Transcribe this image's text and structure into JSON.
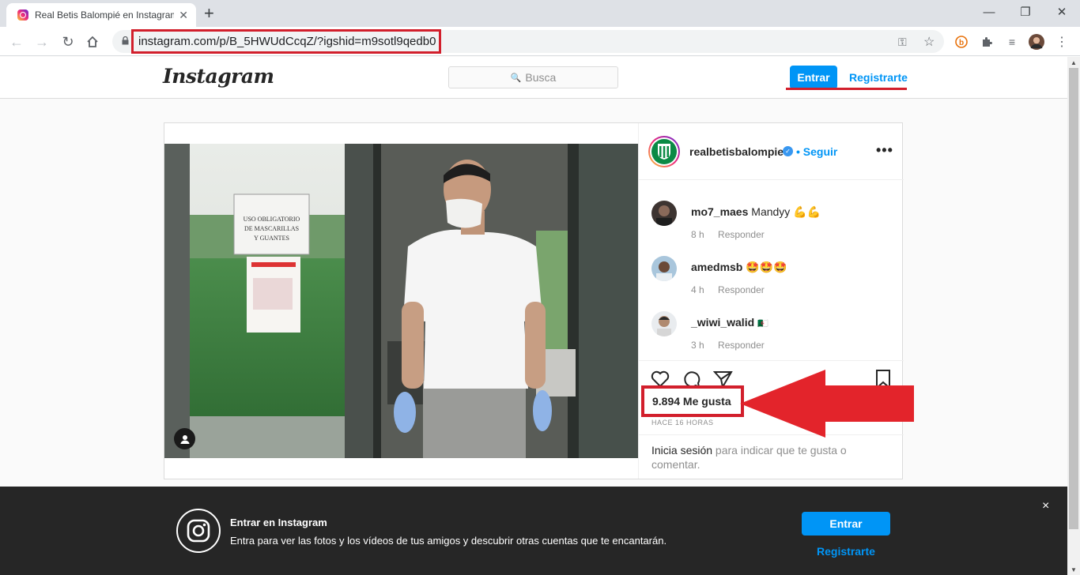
{
  "browser": {
    "tab_title": "Real Betis Balompié en Instagram",
    "url": "instagram.com/p/B_5HWUdCcqZ/?igshid=m9sotl9qedb0"
  },
  "header": {
    "logo": "Instagram",
    "search_placeholder": "Busca",
    "login_label": "Entrar",
    "signup_label": "Registrarte"
  },
  "post": {
    "username": "realbetisbalompie",
    "follow_label": "Seguir",
    "more_label": "•••",
    "comments": [
      {
        "user": "mo7_maes",
        "text": "Mandyy 💪💪",
        "time": "8 h",
        "reply_label": "Responder"
      },
      {
        "user": "amedmsb",
        "text": "🤩🤩🤩",
        "time": "4 h",
        "reply_label": "Responder"
      },
      {
        "user": "_wiwi_walid",
        "text": "🇩🇿",
        "time": "3 h",
        "reply_label": "Responder"
      }
    ],
    "likes": "9.894 Me gusta",
    "time_ago": "HACE 16 HORAS",
    "login_prompt_link": "Inicia sesión",
    "login_prompt_text": " para indicar que te gusta o comentar."
  },
  "photo_sign": {
    "line1": "USO OBLIGATORIO",
    "line2": "DE MASCARILLAS",
    "line3": "Y GUANTES"
  },
  "banner": {
    "title": "Entrar en Instagram",
    "description": "Entra para ver las fotos y los vídeos de tus amigos y descubrir otras cuentas que te encantarán.",
    "login_label": "Entrar",
    "signup_label": "Registrarte",
    "close_label": "×"
  },
  "colors": {
    "accent": "#0095f6",
    "highlight_red": "#d21f2c",
    "banner_bg": "#262626"
  }
}
